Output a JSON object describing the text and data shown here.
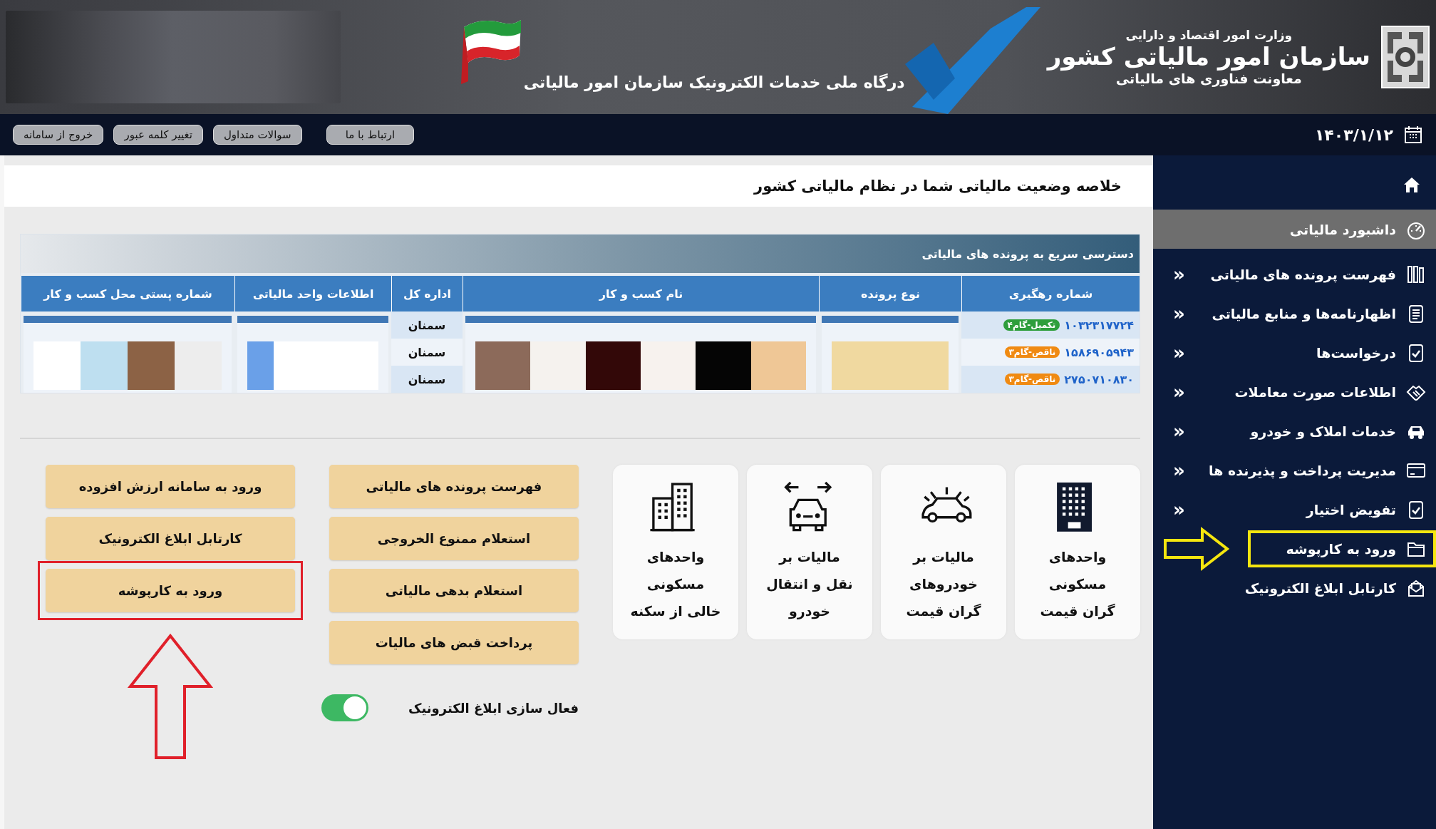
{
  "header": {
    "ministry": "وزارت امور اقتصاد و دارایی",
    "organization": "سازمان امور مالیاتی کشور",
    "deputy": "معاونت فناوری های مالیاتی",
    "portal_title": "درگاه ملی خدمات الکترونیک سازمان امور مالیاتی"
  },
  "toolbar": {
    "date": "۱۴۰۳/۱/۱۲",
    "links": [
      "ارتباط با ما",
      "سوالات متداول",
      "تغییر کلمه عبور",
      "خروج از سامانه"
    ]
  },
  "sidebar": {
    "items": [
      {
        "label": "داشبورد مالیاتی",
        "selected": true,
        "highlighted": false
      },
      {
        "label": "فهرست پرونده های مالیاتی",
        "selected": false,
        "highlighted": false,
        "chevron": "«"
      },
      {
        "label": "اظهارنامه‌ها و منابع مالیاتی",
        "selected": false,
        "highlighted": false,
        "chevron": "«"
      },
      {
        "label": "درخواست‌ها",
        "selected": false,
        "highlighted": false,
        "chevron": "«"
      },
      {
        "label": "اطلاعات صورت معاملات",
        "selected": false,
        "highlighted": false,
        "chevron": "«"
      },
      {
        "label": "خدمات املاک و خودرو",
        "selected": false,
        "highlighted": false,
        "chevron": "«"
      },
      {
        "label": "مدیریت پرداخت و پذیرنده ها",
        "selected": false,
        "highlighted": false,
        "chevron": "«"
      },
      {
        "label": "تفویض اختیار",
        "selected": false,
        "highlighted": false,
        "chevron": "«"
      },
      {
        "label": "ورود به کارپوشه",
        "selected": false,
        "highlighted": true
      },
      {
        "label": "کارتابل ابلاغ الکترونیک",
        "selected": false,
        "highlighted": false
      }
    ]
  },
  "page_title": "خلاصه وضعیت مالیاتی شما در نظام مالیاتی کشور",
  "quick_access": {
    "title": "دسترسی سریع به پرونده های مالیاتی",
    "columns": [
      "شماره رهگیری",
      "نوع پرونده",
      "نام کسب و کار",
      "اداره کل",
      "اطلاعات واحد مالیاتی",
      "شماره پستی محل کسب و کار"
    ],
    "rows": [
      {
        "tracking": "۱۰۳۲۳۱۷۷۲۴",
        "status": "تکمیل-گام۴",
        "color": "#2f9e3c",
        "office": "سمنان"
      },
      {
        "tracking": "۱۵۸۶۹۰۵۹۴۳",
        "status": "ناقص-گام۳",
        "color": "#f08a12",
        "office": "سمنان"
      },
      {
        "tracking": "۲۷۵۰۷۱۰۸۳۰",
        "status": "ناقص-گام۳",
        "color": "#f08a12",
        "office": "سمنان"
      }
    ]
  },
  "tiles": [
    {
      "text": "واحدهای\nمسکونی\nگران قیمت"
    },
    {
      "text": "مالیات بر\nخودروهای\nگران قیمت"
    },
    {
      "text": "مالیات بر\nنقل و انتقال\nخودرو"
    },
    {
      "text": "واحدهای\nمسکونی\nخالی از سکنه"
    }
  ],
  "button_columns": [
    [
      {
        "label": "فهرست پرونده های مالیاتی",
        "highlighted": false
      },
      {
        "label": "استعلام ممنوع الخروجی",
        "highlighted": false
      },
      {
        "label": "استعلام بدهی مالیاتی",
        "highlighted": false
      },
      {
        "label": "پرداخت قبض های مالیات",
        "highlighted": false
      }
    ],
    [
      {
        "label": "ورود به سامانه ارزش افزوده",
        "highlighted": false
      },
      {
        "label": "کارتابل ابلاغ الکترونیک",
        "highlighted": false
      },
      {
        "label": "ورود به کارپوشه",
        "highlighted": true
      }
    ]
  ],
  "toggle": {
    "label": "فعال سازی ابلاغ الکترونیک",
    "on": true
  }
}
